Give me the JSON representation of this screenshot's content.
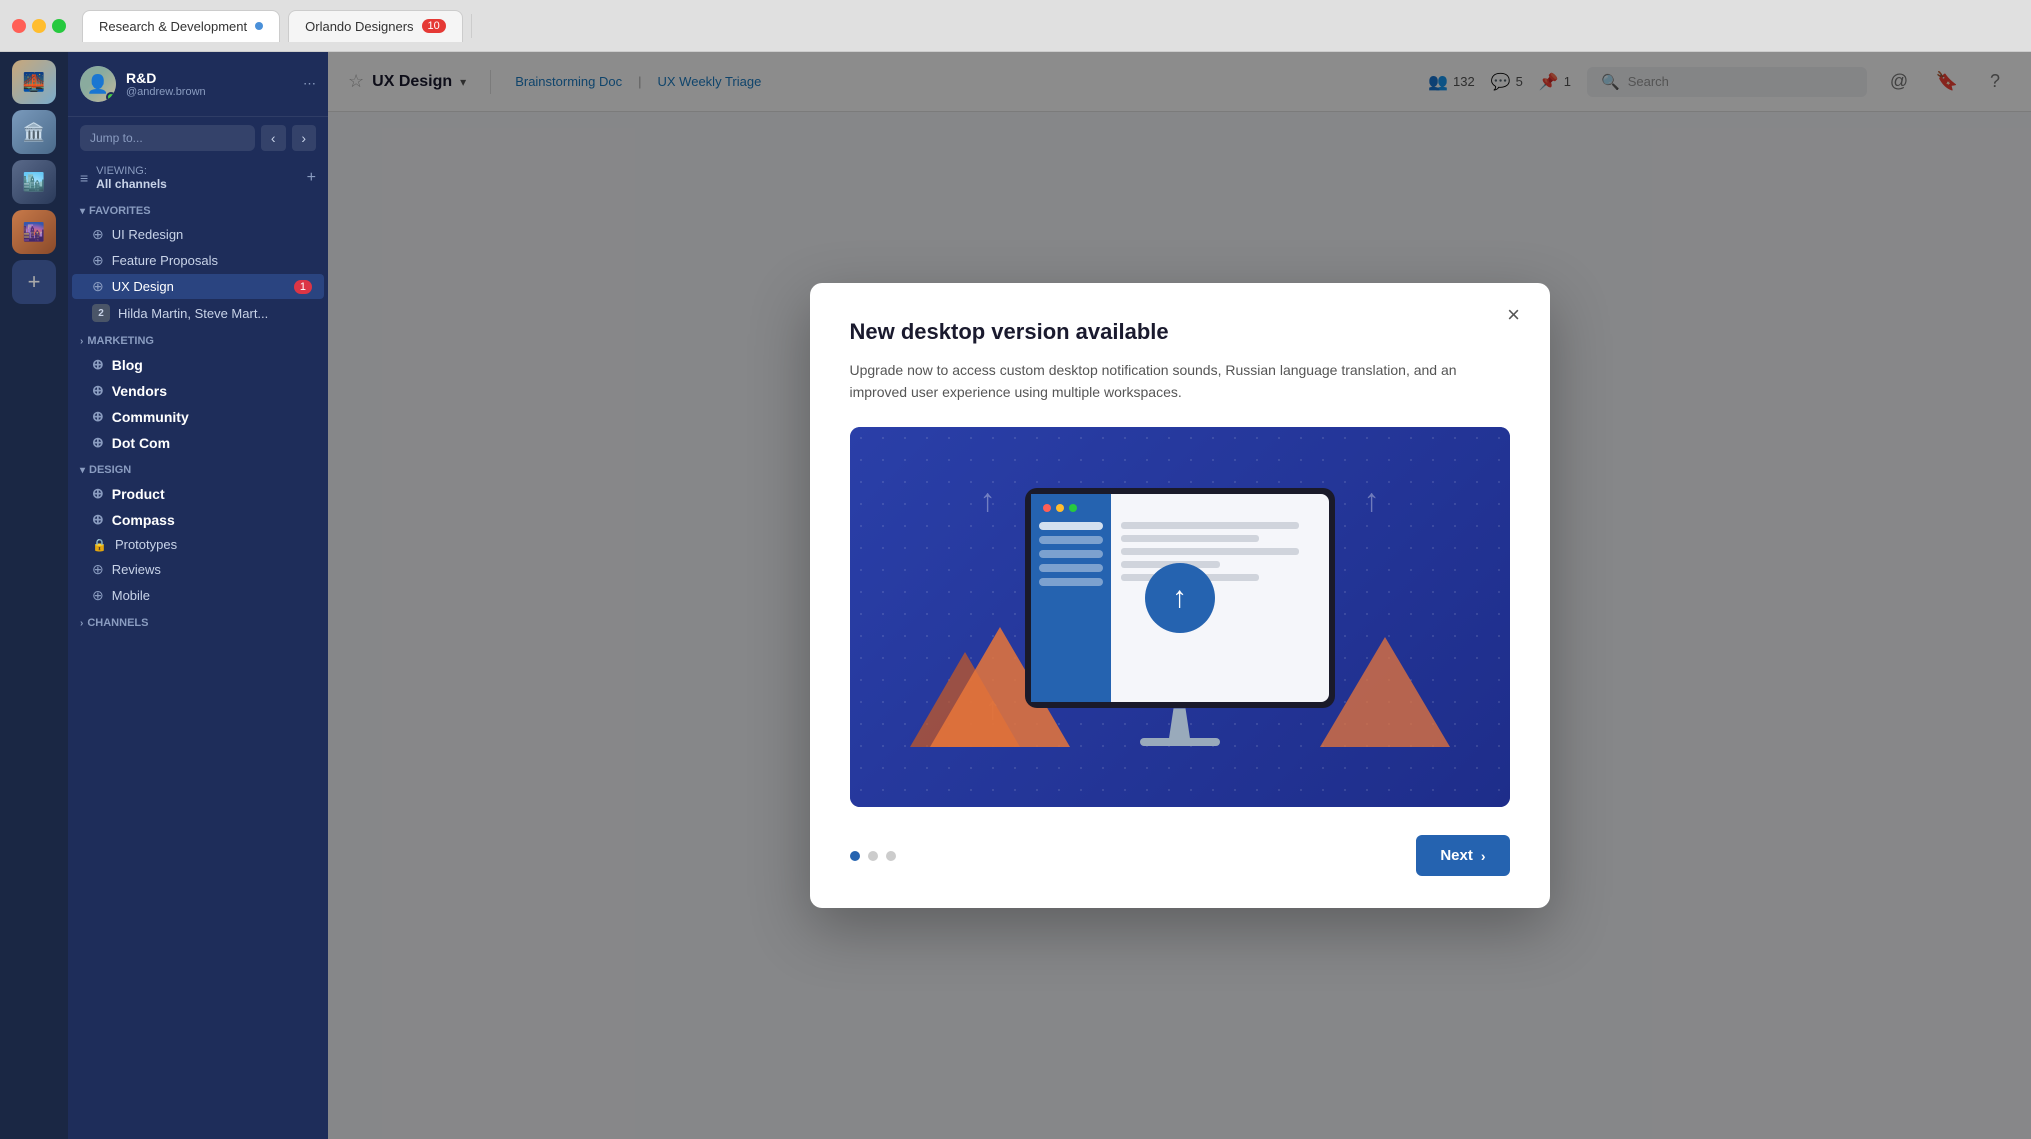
{
  "titlebar": {
    "tabs": [
      {
        "id": "rd",
        "label": "Research & Development",
        "active": true,
        "dot": true
      },
      {
        "id": "od",
        "label": "Orlando Designers",
        "active": false,
        "badge": "10"
      }
    ]
  },
  "workspace_sidebar": {
    "icons": [
      "🌉",
      "🏛️",
      "🏙️",
      "🌆"
    ]
  },
  "channel_sidebar": {
    "user": {
      "name": "R&D",
      "handle": "@andrew.brown"
    },
    "jump_to": {
      "placeholder": "Jump to..."
    },
    "viewing": {
      "label": "VIEWING:",
      "value": "All channels"
    },
    "favorites": {
      "section_label": "FAVORITES",
      "items": [
        {
          "id": "ui-redesign",
          "label": "UI Redesign",
          "type": "channel",
          "active": false
        },
        {
          "id": "feature-proposals",
          "label": "Feature Proposals",
          "type": "channel",
          "active": false
        },
        {
          "id": "ux-design",
          "label": "UX Design",
          "type": "channel",
          "active": true,
          "badge": "1"
        },
        {
          "id": "dm-hilda",
          "label": "Hilda Martin, Steve Mart...",
          "type": "dm",
          "badge_num": "2"
        }
      ]
    },
    "marketing": {
      "section_label": "MARKETING",
      "items": [
        {
          "id": "blog",
          "label": "Blog",
          "type": "channel"
        },
        {
          "id": "vendors",
          "label": "Vendors",
          "type": "channel"
        },
        {
          "id": "community",
          "label": "Community",
          "type": "channel"
        },
        {
          "id": "dot-com",
          "label": "Dot Com",
          "type": "channel"
        }
      ]
    },
    "design": {
      "section_label": "DESIGN",
      "items": [
        {
          "id": "product",
          "label": "Product",
          "type": "channel"
        },
        {
          "id": "compass",
          "label": "Compass",
          "type": "channel"
        },
        {
          "id": "prototypes",
          "label": "Prototypes",
          "type": "channel",
          "locked": true
        },
        {
          "id": "reviews",
          "label": "Reviews",
          "type": "channel"
        },
        {
          "id": "mobile",
          "label": "Mobile",
          "type": "channel"
        }
      ]
    },
    "channels_section_label": "CHANNELS"
  },
  "channel_header": {
    "channel_name": "UX Design",
    "members_count": "132",
    "online_count": "5",
    "pinned_count": "1",
    "breadcrumbs": [
      "Brainstorming Doc",
      "UX Weekly Triage"
    ],
    "search_placeholder": "Search"
  },
  "modal": {
    "title": "New desktop version available",
    "description": "Upgrade now to access custom desktop notification sounds, Russian language translation, and an improved user experience using multiple workspaces.",
    "close_label": "×",
    "next_label": "Next",
    "pagination": {
      "total": 3,
      "current": 0
    }
  }
}
